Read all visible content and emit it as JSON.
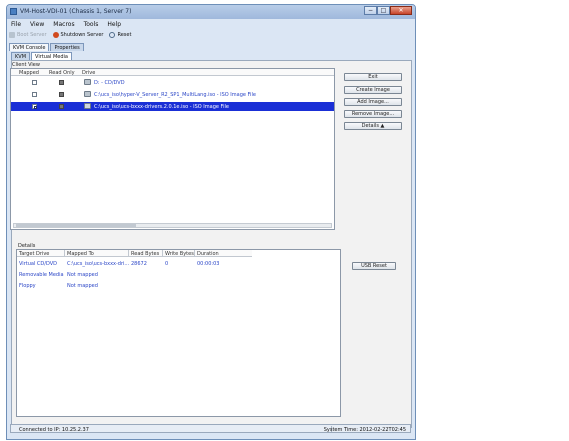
{
  "window": {
    "title": "VM-Host-VDI-01 (Chassis 1, Server 7)",
    "controls": [
      "−",
      "□",
      "✕"
    ]
  },
  "menu": [
    "File",
    "View",
    "Macros",
    "Tools",
    "Help"
  ],
  "toolbar": {
    "boot": "Boot Server",
    "shutdown": "Shutdown Server",
    "reset": "Reset"
  },
  "tabs": [
    "KVM Console",
    "Properties"
  ],
  "subtabs": [
    "KVM",
    "Virtual Media"
  ],
  "client_view": {
    "label": "Client View",
    "headers": [
      "Mapped",
      "Read Only",
      "Drive"
    ],
    "rows": [
      {
        "mapped": false,
        "read_only": true,
        "drive": "D: - CD/DVD"
      },
      {
        "mapped": false,
        "read_only": true,
        "drive": "C:\\ucs_iso\\hyper-V_Server_R2_SP1_MultiLang.iso - ISO Image File"
      },
      {
        "mapped": true,
        "read_only": true,
        "drive": "C:\\ucs_iso\\ucs-bxxx-drivers.2.0.1e.iso - ISO Image File"
      }
    ]
  },
  "buttons": {
    "exit": "Exit",
    "create_image": "Create Image",
    "add_image": "Add Image...",
    "remove_image": "Remove Image...",
    "details": "Details ▲",
    "usb_reset": "USB Reset"
  },
  "details": {
    "label": "Details",
    "headers": [
      "Target Drive",
      "Mapped To",
      "Read Bytes",
      "Write Bytes",
      "Duration"
    ],
    "rows": [
      {
        "target": "Virtual CD/DVD",
        "mapped_to": "C:\\ucs_iso\\ucs-bxxx-dri...",
        "read_bytes": "28672",
        "write_bytes": "0",
        "duration": "00:00:03"
      },
      {
        "target": "Removable Media",
        "mapped_to": "Not mapped",
        "read_bytes": "",
        "write_bytes": "",
        "duration": ""
      },
      {
        "target": "Floppy",
        "mapped_to": "Not mapped",
        "read_bytes": "",
        "write_bytes": "",
        "duration": ""
      }
    ]
  },
  "status": {
    "left": "Connected to IP: 10.25.2.37",
    "right": "System Time: 2012-02-22T02:45"
  }
}
